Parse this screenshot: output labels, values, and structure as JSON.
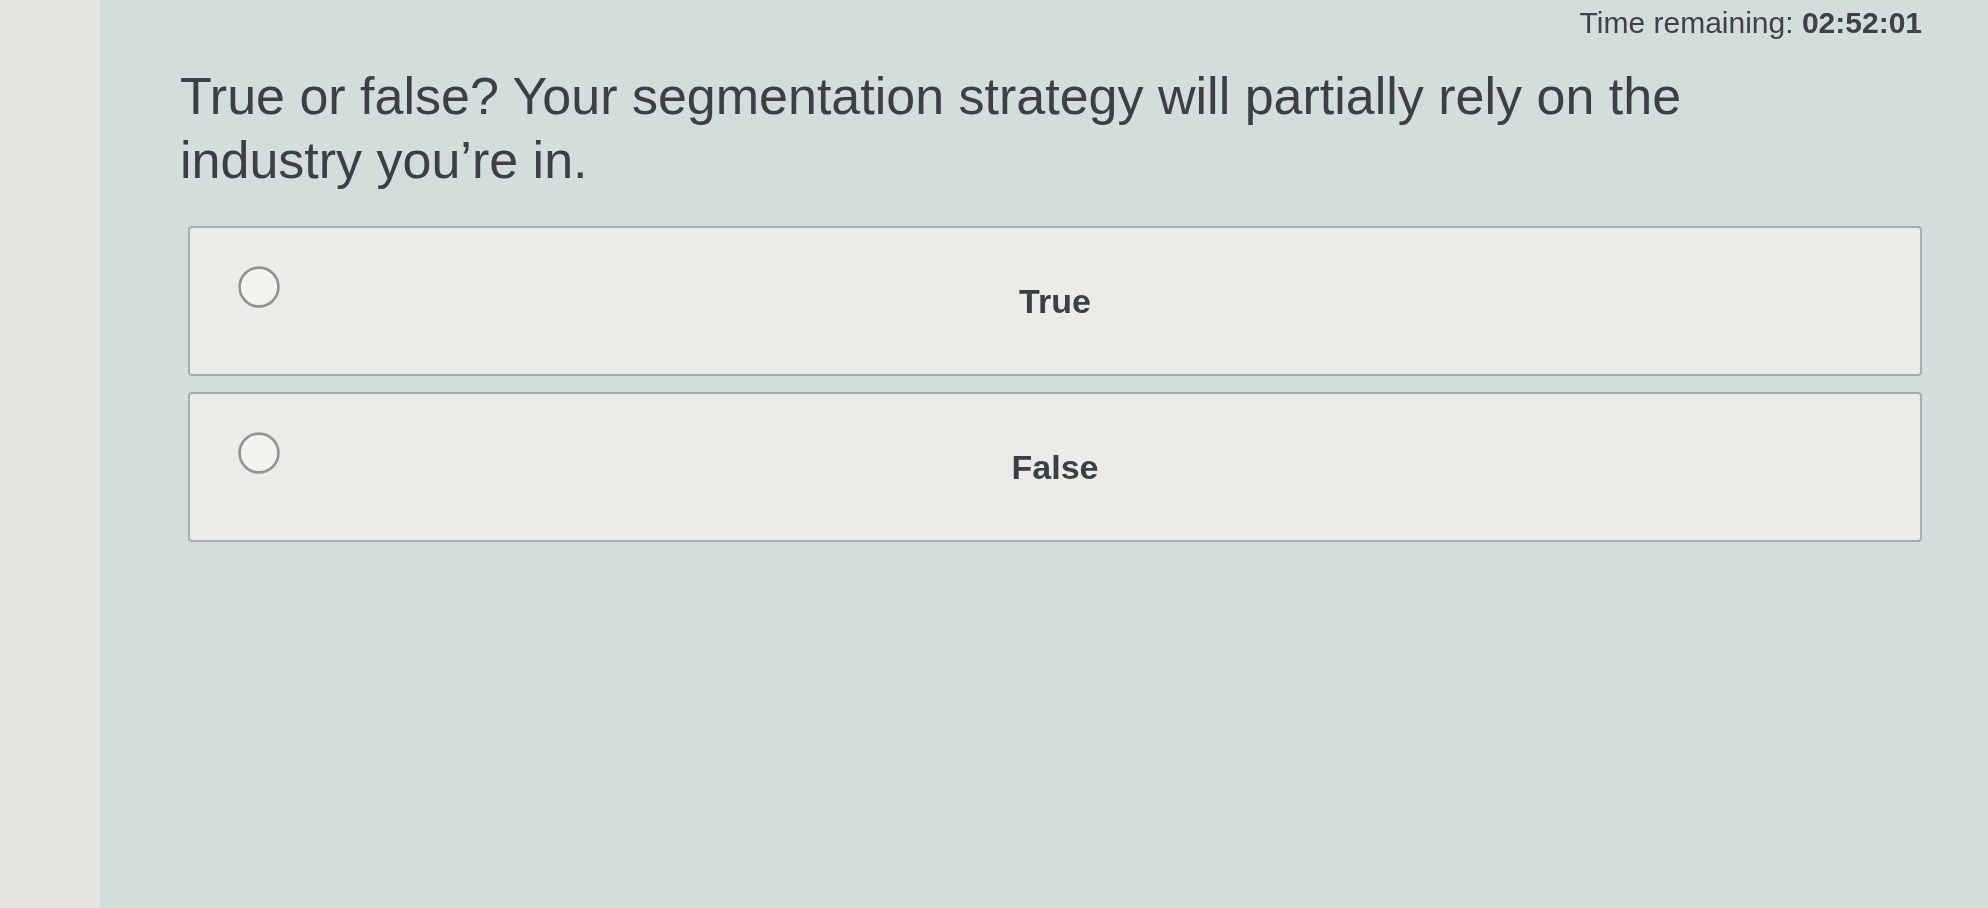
{
  "timer": {
    "text": "Time remaining: **02:52:01**"
  },
  "question": {
    "text": "True or false? Your segmentation strategy will partially rely on the industry you’re in."
  },
  "options": [
    {
      "label": "True",
      "selected": false
    },
    {
      "label": "False",
      "selected": false
    }
  ]
}
